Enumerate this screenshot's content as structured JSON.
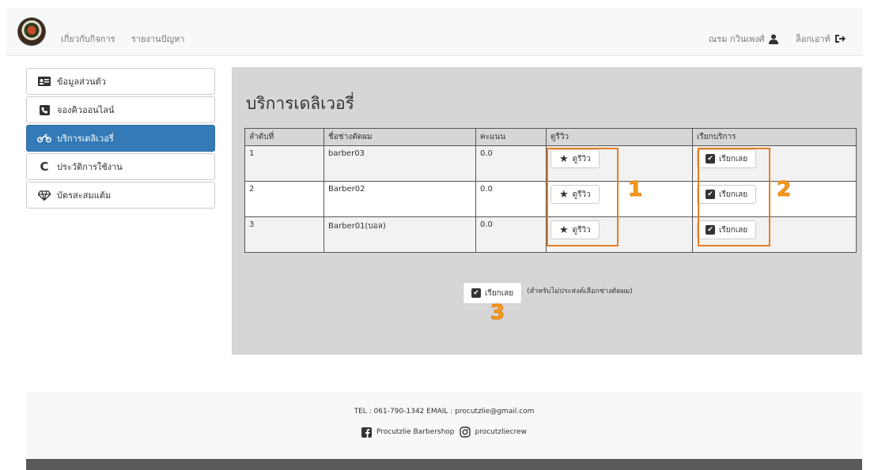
{
  "nav": {
    "links": [
      "เกี่ยวกับกิจการ",
      "รายงานปัญหา"
    ],
    "user_name": "ณรม กวินเพงศ์",
    "logout_label": "ล็อกเอาท์"
  },
  "sidebar": {
    "items": [
      {
        "label": "ข้อมูลส่วนตัว",
        "icon": "id-card-icon"
      },
      {
        "label": "จองคิวออนไลน์",
        "icon": "phone-icon"
      },
      {
        "label": "บริการเดลิเวอรี่",
        "icon": "motorcycle-icon"
      },
      {
        "label": "ประวัติการใช้งาน",
        "icon": "refresh-icon"
      },
      {
        "label": "บัตรสะสมแต้ม",
        "icon": "diamond-icon"
      }
    ],
    "active_index": 2
  },
  "main": {
    "title": "บริการเดลิเวอรี่",
    "table": {
      "headers": [
        "ลำดับที่",
        "ชื่อช่างตัดผม",
        "คะแนน",
        "ดูรีวิว",
        "เรียกบริการ"
      ],
      "rows": [
        {
          "no": "1",
          "name": "barber03",
          "score": "0.0"
        },
        {
          "no": "2",
          "name": "Barber02",
          "score": "0.0"
        },
        {
          "no": "3",
          "name": "Barber01(บอล)",
          "score": "0.0"
        }
      ],
      "review_label": "ดูรีวิว",
      "call_label": "เรียกเลย"
    },
    "quick_call_label": "เรียกเลย",
    "quick_call_note": "(สำหรับไม่ประสงค์เลือกช่างตัดผม)",
    "annotations": [
      "1",
      "2",
      "3"
    ],
    "annotation_color": "#e67e22"
  },
  "footer": {
    "contact": "TEL : 061-790-1342 EMAIL : procutzlie@gmail.com",
    "facebook": "Procutzlie Barbershop",
    "instagram": "procutzliecrew"
  },
  "colors": {
    "accent": "#337ab7",
    "panel": "#d6d6d6"
  }
}
